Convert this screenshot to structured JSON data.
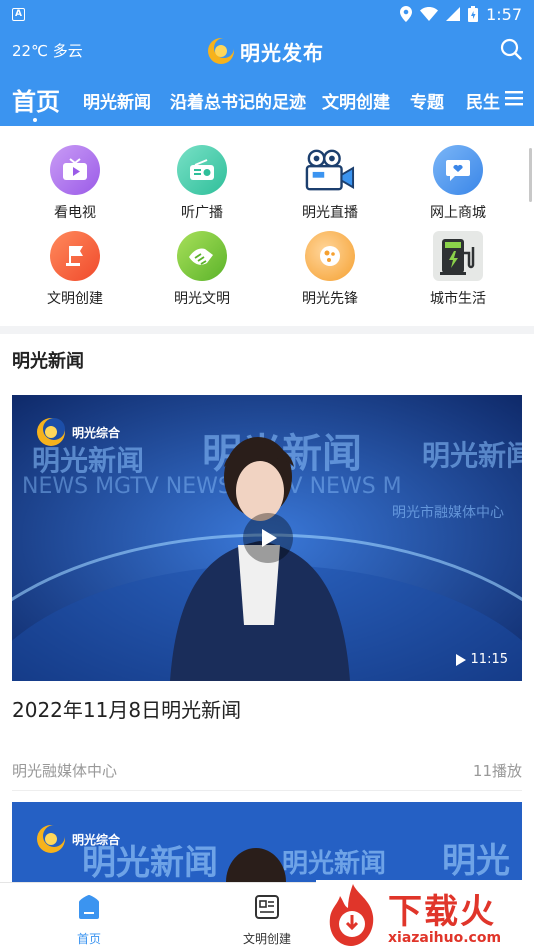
{
  "status_bar": {
    "badge": "A",
    "time": "1:57"
  },
  "header": {
    "weather": "22℃ 多云",
    "brand_title": "明光发布"
  },
  "nav": {
    "tabs": [
      "首页",
      "明光新闻",
      "沿着总书记的足迹",
      "文明创建",
      "专题",
      "民生"
    ]
  },
  "grid": {
    "items": [
      {
        "label": "看电视",
        "icon": "tv-icon"
      },
      {
        "label": "听广播",
        "icon": "radio-icon"
      },
      {
        "label": "明光直播",
        "icon": "video-camera-icon"
      },
      {
        "label": "网上商城",
        "icon": "shop-heart-icon"
      },
      {
        "label": "文明创建",
        "icon": "flag-icon"
      },
      {
        "label": "明光文明",
        "icon": "handshake-icon"
      },
      {
        "label": "明光先锋",
        "icon": "pioneer-icon"
      },
      {
        "label": "城市生活",
        "icon": "charging-station-icon"
      }
    ]
  },
  "section": {
    "title": "明光新闻"
  },
  "video1": {
    "channel": "明光综合",
    "screen_title": "明光新闻",
    "screen_sub": "NEWS  MGTV  NEWS",
    "screen_center": "明光市融媒体中心",
    "duration": "11:15"
  },
  "news": {
    "title": "2022年11月8日明光新闻",
    "source": "明光融媒体中心",
    "plays": "11播放"
  },
  "video2": {
    "channel": "明光综合",
    "screen_title": "明光新闻"
  },
  "bottom_nav": {
    "items": [
      "首页",
      "文明创建"
    ]
  },
  "watermark": {
    "text": "下载火",
    "sub": "xiazaihuo.com"
  },
  "colors": {
    "primary": "#3b94f0",
    "watermark": "#e0352a"
  }
}
